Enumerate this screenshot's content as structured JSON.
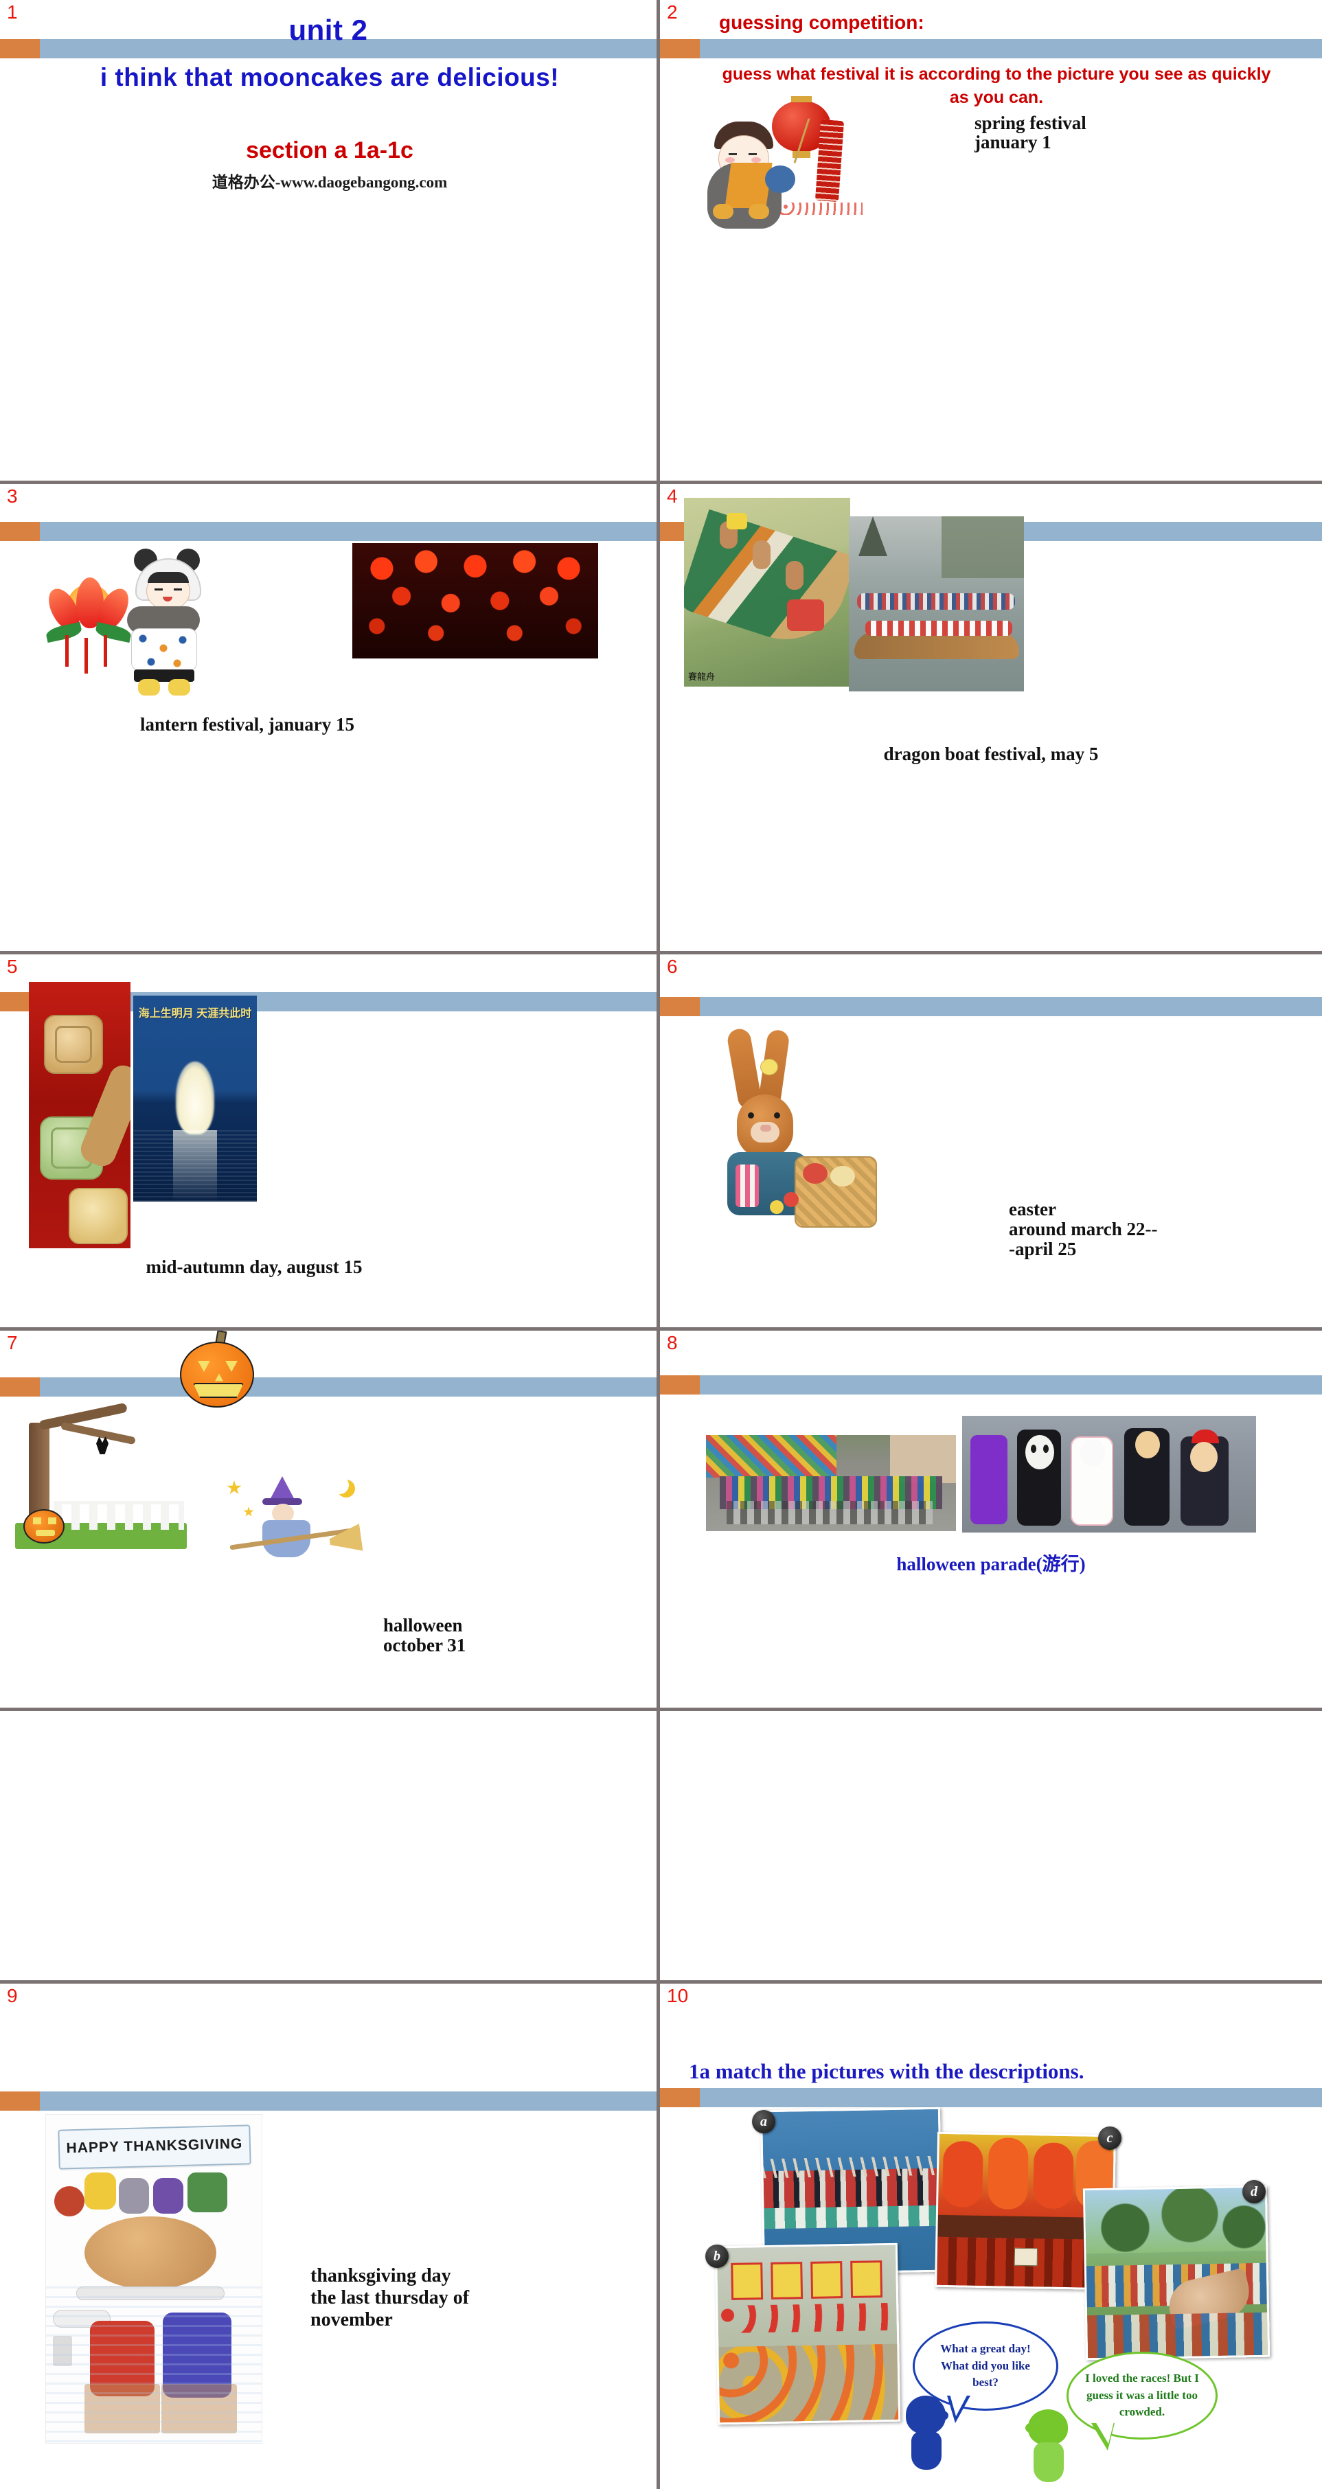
{
  "document": {
    "kind": "powerpoint-slide-contact-sheet",
    "columns": 2,
    "rows": 5,
    "watermark": "道格办公",
    "accent_orange": "#d98141",
    "accent_blue_band": "#93b3cf",
    "divider_grey": "#7b7373",
    "slide_number_color": "#e8170d"
  },
  "slides": [
    {
      "number": "1",
      "title_top": "unit 2",
      "heading": "i think that mooncakes are delicious!",
      "subheading": "section a 1a-1c",
      "footer": "道格办公-www.daogebangong.com"
    },
    {
      "number": "2",
      "title": "guessing competition:",
      "instruction": "guess what festival it is according to the picture you see as quickly as you can.",
      "answer_line1": "spring festival",
      "answer_line2": "january 1",
      "image_alt": "boy-with-lantern-and-firecrackers"
    },
    {
      "number": "3",
      "caption": "lantern festival, january 15",
      "image_alt_1": "panda-child-with-lotus-lantern",
      "image_alt_2": "red-lanterns-temple-night"
    },
    {
      "number": "4",
      "caption": "dragon boat festival, may 5",
      "image_alt_1": "dragon-boat-rowers",
      "image_alt_2": "dragon-boat-race-river",
      "image_overlay_text": "賽龍舟"
    },
    {
      "number": "5",
      "caption": "mid-autumn day, august 15",
      "image_alt_1": "mooncakes-on-red-cloth",
      "image_alt_2": "moon-over-sea",
      "image_2_text": "海上生明月  天涯共此时"
    },
    {
      "number": "6",
      "answer_line1": "easter",
      "answer_line2": "around march 22--",
      "answer_line3": "-april 25",
      "image_alt": "easter-bunny-with-basket"
    },
    {
      "number": "7",
      "answer_line1": "halloween",
      "answer_line2": "october 31",
      "image_alt_1": "jack-o-lantern-pumpkin",
      "image_alt_2": "spooky-tree-with-bat-and-fence",
      "image_alt_3": "witch-on-broom-with-stars-and-moon"
    },
    {
      "number": "8",
      "caption": "halloween parade(游行)",
      "image_alt_1": "costume-parade-street",
      "image_alt_2": "children-in-halloween-costumes"
    },
    {
      "number": "9",
      "answer_line1": "thanksgiving day",
      "answer_line2": "the last thursday of",
      "answer_line3": "november",
      "image_alt": "happy-thanksgiving-turkey-cartoon",
      "image_banner_text": "HAPPY THANKSGIVING"
    },
    {
      "number": "10",
      "title": "1a match the pictures with the descriptions.",
      "photo_labels": [
        "a",
        "b",
        "c",
        "d"
      ],
      "photo_alts": [
        "dragon-boat-race",
        "lantern-and-flower-decorations",
        "red-lanterns-close-up",
        "water-splashing-festival"
      ],
      "bubble_blue": "What a great day! What did you like best?",
      "bubble_green": "I loved the races! But I guess it was a little too crowded."
    }
  ]
}
